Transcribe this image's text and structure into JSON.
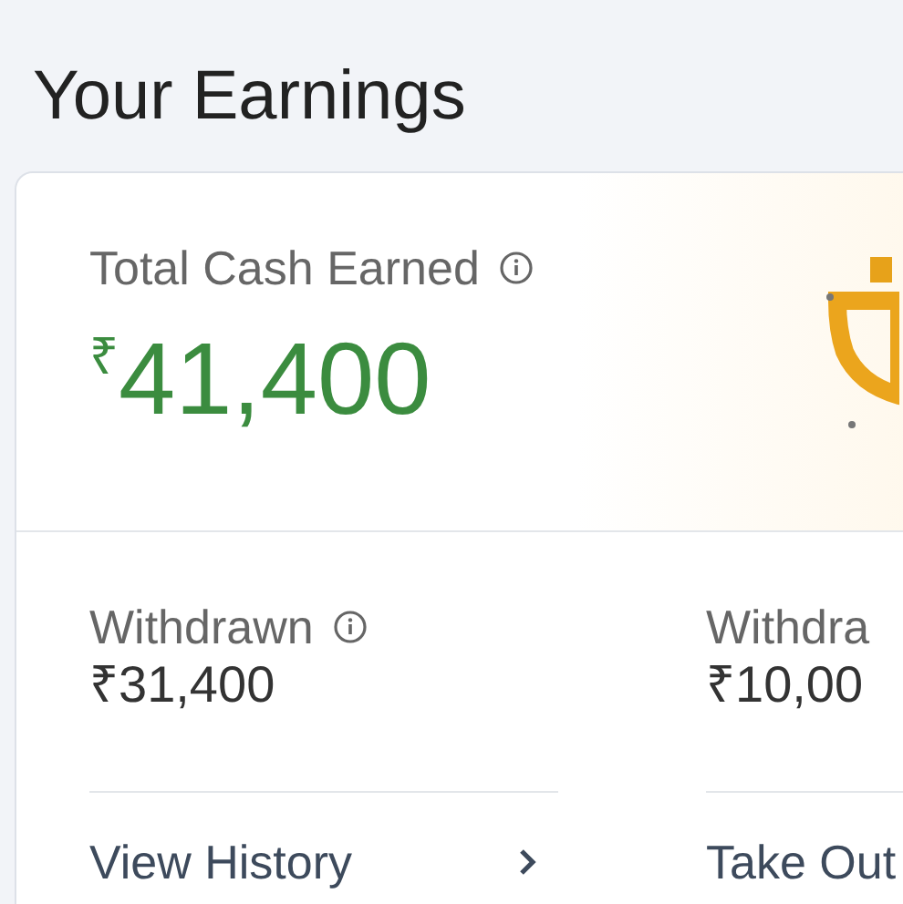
{
  "page_title": "Your Earnings",
  "total": {
    "label": "Total Cash Earned",
    "amount": "$^{₹}$41,400"
  },
  "stats": [
    {
      "label": "Withdrawn",
      "info": true,
      "value": "₹31,400",
      "action": "View History",
      "chevron": true
    },
    {
      "label": "Withdra",
      "info": false,
      "value": "₹10,00",
      "action": "Take Out"
    }
  ]
}
